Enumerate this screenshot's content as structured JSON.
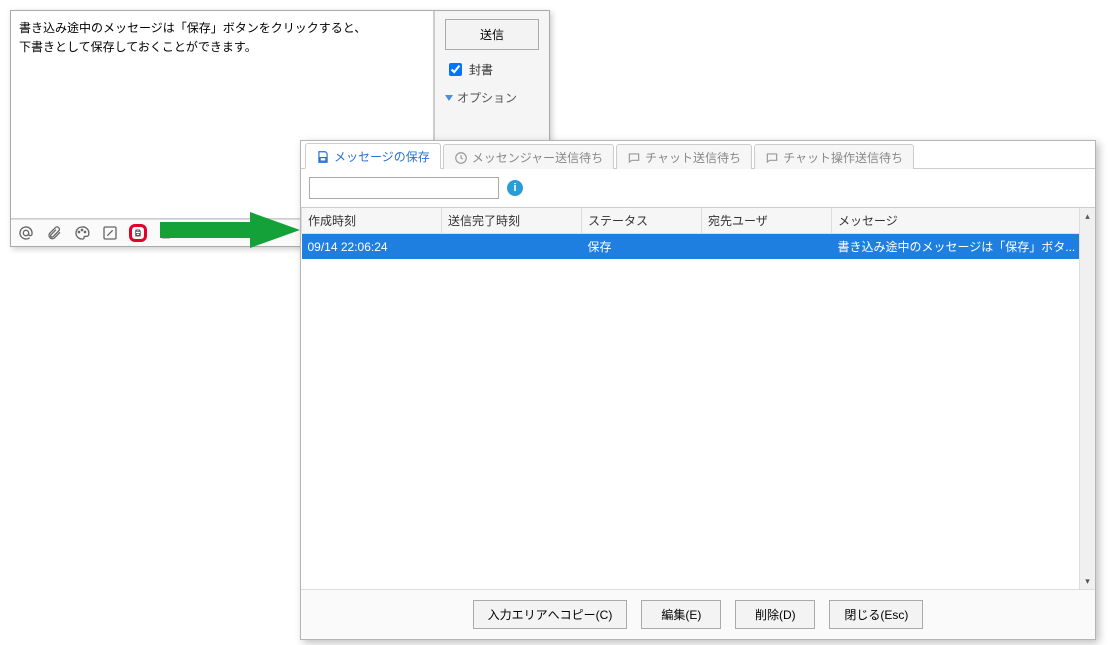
{
  "compose": {
    "message_text": "書き込み途中のメッセージは「保存」ボタンをクリックすると、\n下書きとして保存しておくことができます。",
    "send_label": "送信",
    "sealed_label": "封書",
    "sealed_checked": true,
    "options_label": "オプション"
  },
  "dialog": {
    "tabs": [
      {
        "label": "メッセージの保存"
      },
      {
        "label": "メッセンジャー送信待ち"
      },
      {
        "label": "チャット送信待ち"
      },
      {
        "label": "チャット操作送信待ち"
      }
    ],
    "search_placeholder": "",
    "columns": {
      "created": "作成時刻",
      "sent": "送信完了時刻",
      "status": "ステータス",
      "dest": "宛先ユーザ",
      "msg": "メッセージ"
    },
    "rows": [
      {
        "created": "09/14  22:06:24",
        "sent": "",
        "status": "保存",
        "dest": "",
        "msg": "書き込み途中のメッセージは「保存」ボタ..."
      }
    ],
    "buttons": {
      "copy": "入力エリアへコピー(C)",
      "edit": "編集(E)",
      "delete": "削除(D)",
      "close": "閉じる(Esc)"
    }
  }
}
